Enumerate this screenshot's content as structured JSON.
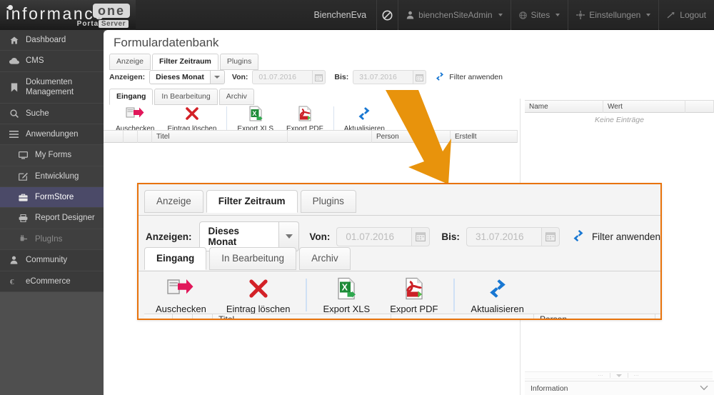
{
  "branding": {
    "logo_text": "informance",
    "logo_badge": "one",
    "logo_sub_portal": "Portal",
    "logo_sub_server": "Server"
  },
  "topnav": {
    "user_name": "BienchenEva",
    "block_icon": "no-entry-icon",
    "items": [
      {
        "label": "bienchenSiteAdmin",
        "icon": "user-icon",
        "caret": true
      },
      {
        "label": "Sites",
        "icon": "globe-icon",
        "caret": true
      },
      {
        "label": "Einstellungen",
        "icon": "gear-icon",
        "caret": true
      },
      {
        "label": "Logout",
        "icon": "logout-arrow-icon",
        "caret": false
      }
    ]
  },
  "sidebar": {
    "items": [
      {
        "label": "Dashboard",
        "icon": "home-icon",
        "level": "group",
        "active": false,
        "dim": false
      },
      {
        "label": "CMS",
        "icon": "cloud-icon",
        "level": "group",
        "active": false,
        "dim": false
      },
      {
        "label": "Dokumenten Management",
        "icon": "bookmark-icon",
        "level": "group",
        "active": false,
        "dim": false
      },
      {
        "label": "Suche",
        "icon": "search-icon",
        "level": "group",
        "active": false,
        "dim": false
      },
      {
        "label": "Anwendungen",
        "icon": "menu-icon",
        "level": "group",
        "active": false,
        "dim": false
      },
      {
        "label": "My Forms",
        "icon": "monitor-icon",
        "level": "sub",
        "active": false,
        "dim": false
      },
      {
        "label": "Entwicklung",
        "icon": "edit-icon",
        "level": "sub",
        "active": false,
        "dim": false
      },
      {
        "label": "FormStore",
        "icon": "briefcase-icon",
        "level": "sub",
        "active": true,
        "dim": false
      },
      {
        "label": "Report Designer",
        "icon": "printer-icon",
        "level": "sub",
        "active": false,
        "dim": false
      },
      {
        "label": "PlugIns",
        "icon": "plug-icon",
        "level": "sub",
        "active": false,
        "dim": true
      },
      {
        "label": "Community",
        "icon": "person-icon",
        "level": "group",
        "active": false,
        "dim": false
      },
      {
        "label": "eCommerce",
        "icon": "euro-icon",
        "level": "group",
        "active": false,
        "dim": false
      }
    ]
  },
  "main": {
    "page_title": "Formulardatenbank",
    "top_tabs": [
      {
        "label": "Anzeige",
        "active": false
      },
      {
        "label": "Filter Zeitraum",
        "active": true
      },
      {
        "label": "Plugins",
        "active": false
      }
    ],
    "filter": {
      "anzeigen_label": "Anzeigen:",
      "range_value": "Dieses Monat",
      "von_label": "Von:",
      "von_value": "01.07.2016",
      "bis_label": "Bis:",
      "bis_value": "31.07.2016",
      "apply_label": "Filter anwenden",
      "apply_icon": "refresh-icon",
      "calendar_icon": "calendar-icon"
    },
    "status_tabs": [
      {
        "label": "Eingang",
        "active": true
      },
      {
        "label": "In Bearbeitung",
        "active": false
      },
      {
        "label": "Archiv",
        "active": false
      }
    ],
    "toolbar": [
      {
        "label": "Auschecken",
        "icon": "checkout-icon"
      },
      {
        "label": "Eintrag löschen",
        "icon": "delete-x-icon"
      },
      {
        "sep": true
      },
      {
        "label": "Export XLS",
        "icon": "excel-file-icon"
      },
      {
        "label": "Export PDF",
        "icon": "pdf-file-icon"
      },
      {
        "sep": true
      },
      {
        "label": "Aktualisieren",
        "icon": "refresh-icon"
      }
    ],
    "table": {
      "columns": [
        "",
        "",
        "",
        "Titel",
        "",
        "Person",
        "Erstellt",
        ""
      ]
    }
  },
  "right_panel": {
    "columns": [
      "Name",
      "Wert",
      ""
    ],
    "empty_message": "Keine Einträge",
    "info_label": "Information",
    "info_chevron": "chevron-down-icon"
  },
  "callout": {
    "top_tabs": [
      {
        "label": "Anzeige",
        "active": false
      },
      {
        "label": "Filter Zeitraum",
        "active": true
      },
      {
        "label": "Plugins",
        "active": false
      }
    ],
    "filter": {
      "anzeigen_label": "Anzeigen:",
      "range_value": "Dieses Monat",
      "von_label": "Von:",
      "von_value": "01.07.2016",
      "bis_label": "Bis:",
      "bis_value": "31.07.2016",
      "apply_label": "Filter anwenden"
    },
    "status_tabs": [
      {
        "label": "Eingang",
        "active": true
      },
      {
        "label": "In Bearbeitung",
        "active": false
      },
      {
        "label": "Archiv",
        "active": false
      }
    ],
    "toolbar": [
      {
        "label": "Auschecken",
        "icon": "checkout-icon"
      },
      {
        "label": "Eintrag löschen",
        "icon": "delete-x-icon"
      },
      {
        "sep": true
      },
      {
        "label": "Export XLS",
        "icon": "excel-file-icon"
      },
      {
        "label": "Export PDF",
        "icon": "pdf-file-icon"
      },
      {
        "sep": true
      },
      {
        "label": "Aktualisieren",
        "icon": "refresh-icon"
      }
    ],
    "table_columns": [
      "",
      "",
      "",
      "Titel",
      "",
      "Person"
    ]
  },
  "colors": {
    "accent_orange": "#e8730c",
    "arrow_orange": "#e8930c",
    "sidebar_active": "#4b4a68",
    "topbar_dark": "#262626",
    "excel_green": "#1e8b38",
    "pdf_red": "#cc2127",
    "refresh_blue": "#1877d2"
  }
}
